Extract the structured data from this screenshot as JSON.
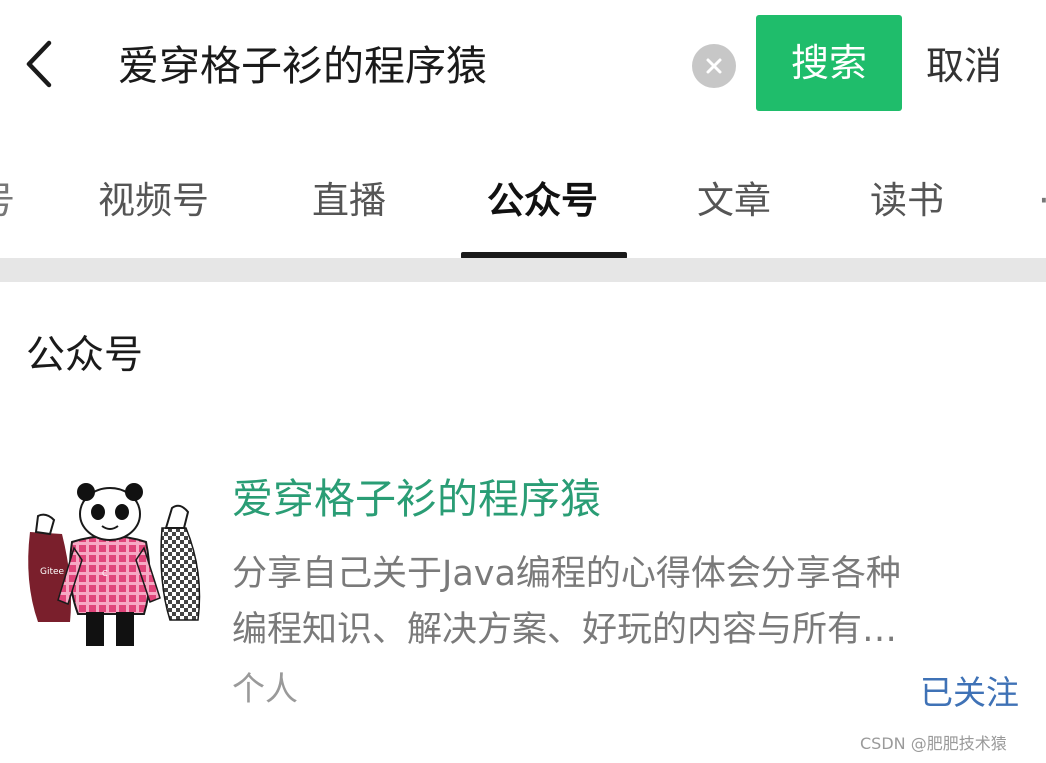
{
  "search": {
    "query": "爱穿格子衫的程序猿",
    "search_button_label": "搜索",
    "cancel_label": "取消",
    "icons": {
      "back": "chevron-left-icon",
      "clear": "clear-circle-icon"
    }
  },
  "tabs": {
    "partial_left": "号",
    "items": [
      {
        "label": "视频号"
      },
      {
        "label": "直播"
      },
      {
        "label": "公众号",
        "active": true
      },
      {
        "label": "文章"
      },
      {
        "label": "读书"
      }
    ],
    "partial_right": "·"
  },
  "section": {
    "title": "公众号"
  },
  "result": {
    "name": "爱穿格子衫的程序猿",
    "description_lines": [
      "分享自己关于Java编程的心得体会分享各种",
      "编程知识、解决方案、好玩的内容与所有…"
    ],
    "type": "个人",
    "follow_status": "已关注",
    "avatar_icon": "panda-plaid-shirt-avatar"
  },
  "watermark": "CSDN @肥肥技术猿",
  "colors": {
    "accent_green": "#1fbd6b",
    "name_green": "#2a9d75",
    "follow_blue": "#3f72b6",
    "separator": "#e6e6e6"
  }
}
